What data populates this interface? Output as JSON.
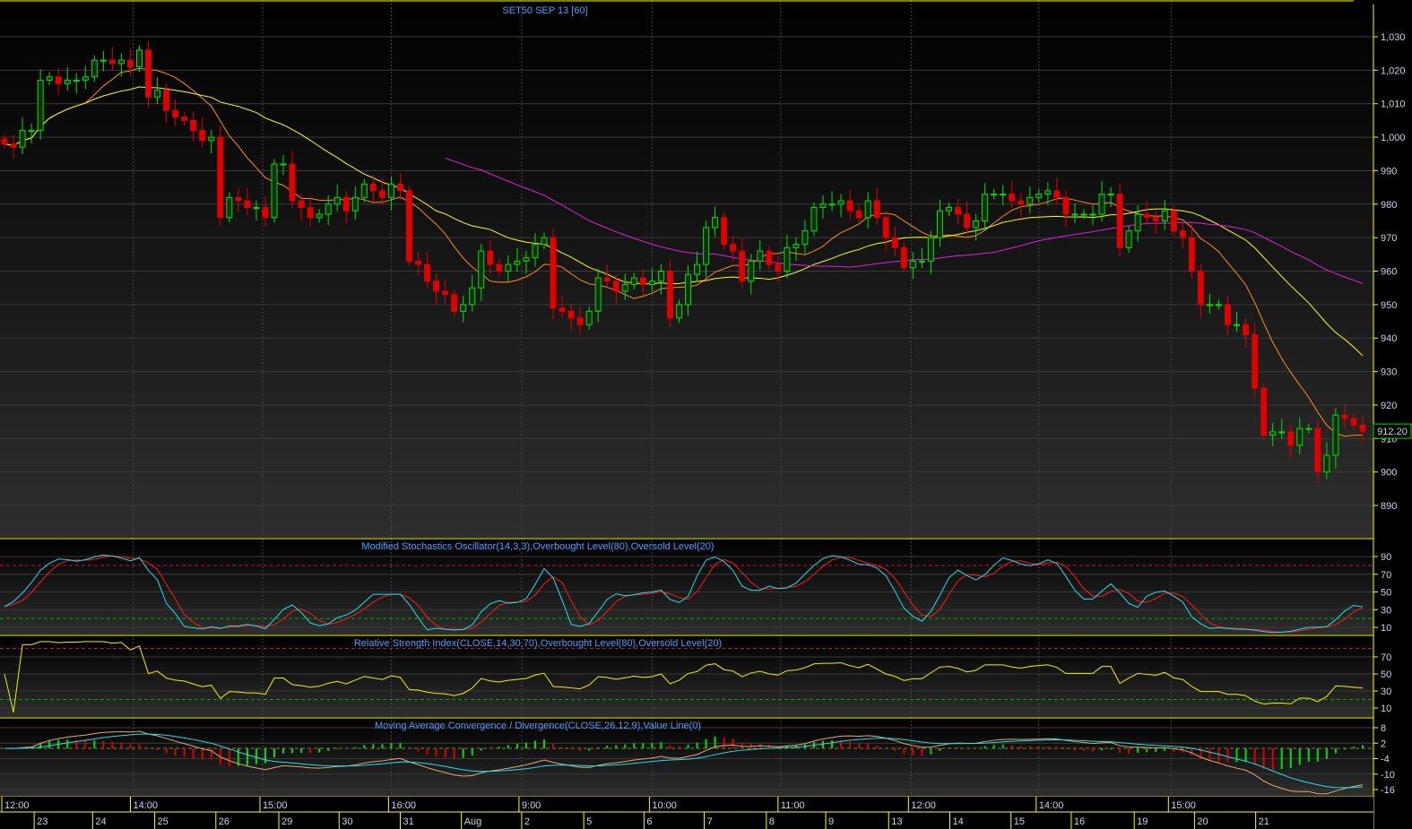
{
  "title": "SET50 SEP 13   [60]",
  "last_price_label": "912.20",
  "colors": {
    "axis": "#ffff00",
    "label": "#c8d4e8",
    "title": "#4aa0ff",
    "up": "#00e000",
    "down": "#e00000",
    "ma_fast": "#ff8c1a",
    "ma_mid": "#ffff00",
    "ma_slow": "#e020e0",
    "stoch_k": "#20e0e8",
    "stoch_d": "#ff1a1a",
    "rsi": "#f0f000",
    "macd": "#e0a878",
    "signal": "#20e0e8",
    "overbought": "#c0104a",
    "oversold": "#00b000"
  },
  "chart_data": {
    "type": "candlestick",
    "title": "SET50 SEP 13 [60]",
    "close": [
      998,
      997,
      1002,
      1002,
      1017,
      1018,
      1016,
      1017,
      1017,
      1018,
      1023,
      1023,
      1022,
      1023,
      1021,
      1026,
      1012,
      1014,
      1008,
      1006,
      1005,
      1002,
      999,
      1000,
      976,
      982,
      981,
      979,
      979,
      976,
      992,
      992,
      981,
      979,
      976,
      977,
      980,
      982,
      978,
      982,
      986,
      984,
      982,
      986,
      984,
      963,
      962,
      957,
      954,
      953,
      948,
      950,
      955,
      966,
      962,
      960,
      962,
      963,
      964,
      968,
      970,
      949,
      948,
      946,
      944,
      948,
      958,
      957,
      954,
      956,
      958,
      956,
      957,
      960,
      946,
      950,
      959,
      962,
      973,
      976,
      968,
      966,
      957,
      963,
      966,
      962,
      960,
      967,
      968,
      972,
      979,
      980,
      980,
      981,
      978,
      976,
      981,
      976,
      970,
      967,
      961,
      963,
      963,
      970,
      978,
      979,
      977,
      973,
      975,
      983,
      983,
      983,
      981,
      980,
      982,
      983,
      984,
      982,
      977,
      977,
      977,
      977,
      983,
      983,
      967,
      972,
      977,
      976,
      975,
      978,
      972,
      970,
      960,
      950,
      950,
      950,
      944,
      944,
      941,
      925,
      911,
      912,
      912,
      908,
      913,
      913,
      900,
      905,
      917,
      916,
      914,
      912.2
    ],
    "price_axis": {
      "ticks": [
        "1,030",
        "1,020",
        "1,010",
        "1,000",
        "990",
        "980",
        "970",
        "960",
        "950",
        "940",
        "930",
        "920",
        "910",
        "900",
        "890"
      ],
      "values": [
        1030,
        1020,
        1010,
        1000,
        990,
        980,
        970,
        960,
        950,
        940,
        930,
        920,
        910,
        900,
        890
      ]
    },
    "moving_averages": [
      {
        "name": "fast",
        "period": 10
      },
      {
        "name": "mid",
        "period": 25
      },
      {
        "name": "slow",
        "period": 50
      }
    ],
    "panels": [
      {
        "id": "stoch",
        "title": "Modified Stochastics Oscillator(14,3,3),Overbought Level(80),Oversold Level(20)",
        "ticks": [
          90,
          70,
          50,
          30,
          10
        ],
        "range": [
          0,
          100
        ],
        "overbought": 80,
        "oversold": 20
      },
      {
        "id": "rsi",
        "title": "Relative Strength Index(CLOSE,14,30,70),Overbought Level(80),Oversold Level(20)",
        "ticks": [
          70,
          50,
          30,
          10
        ],
        "range": [
          0,
          90
        ],
        "overbought": 80,
        "oversold": 20
      },
      {
        "id": "macd",
        "title": "Moving Average Convergence / Divergence(CLOSE,26,12,9),Value Line(0)",
        "ticks": [
          8,
          2,
          -4,
          -10,
          -16
        ],
        "range": [
          -18.5,
          9.5
        ],
        "value_line": 0
      }
    ],
    "time_labels": [
      {
        "t": "12:00",
        "bar": 0
      },
      {
        "t": "14:00",
        "bar": 14.3
      },
      {
        "t": "15:00",
        "bar": 28.7
      },
      {
        "t": "16:00",
        "bar": 43
      },
      {
        "t": "9:00",
        "bar": 57.5
      },
      {
        "t": "10:00",
        "bar": 72
      },
      {
        "t": "11:00",
        "bar": 86.3
      },
      {
        "t": "12:00",
        "bar": 100.8
      },
      {
        "t": "14:00",
        "bar": 115
      },
      {
        "t": "15:00",
        "bar": 129.7
      }
    ],
    "date_labels": [
      {
        "t": "23",
        "bar": 3.3
      },
      {
        "t": "24",
        "bar": 10
      },
      {
        "t": "25",
        "bar": 16.9
      },
      {
        "t": "26",
        "bar": 23.7
      },
      {
        "t": "29",
        "bar": 30.7
      },
      {
        "t": "30",
        "bar": 37.4
      },
      {
        "t": "31",
        "bar": 44.2
      },
      {
        "t": "Aug",
        "bar": 51
      },
      {
        "t": "2",
        "bar": 57.7
      },
      {
        "t": "5",
        "bar": 64.6
      },
      {
        "t": "6",
        "bar": 71.3
      },
      {
        "t": "7",
        "bar": 78
      },
      {
        "t": "8",
        "bar": 84.9
      },
      {
        "t": "9",
        "bar": 91.5
      },
      {
        "t": "13",
        "bar": 98.5
      },
      {
        "t": "14",
        "bar": 105.3
      },
      {
        "t": "15",
        "bar": 112.1
      },
      {
        "t": "16",
        "bar": 118.8
      },
      {
        "t": "19",
        "bar": 125.8
      },
      {
        "t": "20",
        "bar": 132.5
      },
      {
        "t": "21",
        "bar": 139.3
      }
    ]
  }
}
